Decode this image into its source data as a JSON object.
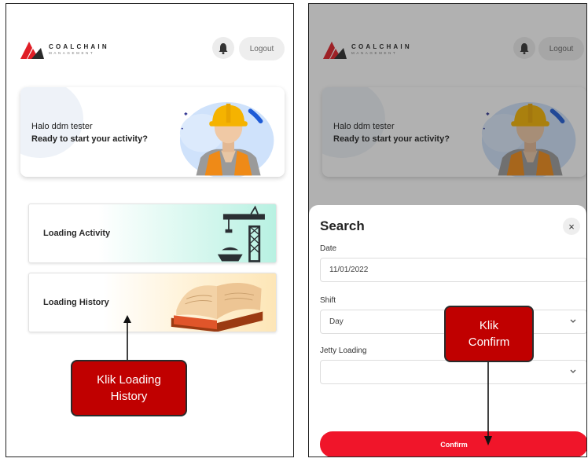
{
  "app": {
    "brand": "COALCHAIN",
    "brand_sub": "MANAGEMENT",
    "logout_label": "Logout",
    "icons": [
      "coalchain-logo-icon",
      "bell-icon",
      "worker-illustration-icon",
      "crane-icon",
      "book-icon",
      "close-icon",
      "chevron-down-icon"
    ]
  },
  "home": {
    "greeting": "Halo ddm tester",
    "subtitle": "Ready to start your activity?",
    "cards": [
      {
        "label": "Loading Activity"
      },
      {
        "label": "Loading History"
      }
    ],
    "annotation": [
      "Klik Loading",
      "History"
    ]
  },
  "search_modal": {
    "title": "Search",
    "close_label": "×",
    "date_label": "Date",
    "date_value": "11/01/2022",
    "shift_label": "Shift",
    "shift_value": "Day",
    "jetty_label": "Jetty Loading",
    "jetty_value": "",
    "confirm_label": "Confirm",
    "annotation": [
      "Klik",
      "Confirm"
    ]
  },
  "colors": {
    "accent": "#f0152a",
    "annotation_fill": "#c00000",
    "activity_card": "#b8f1e2",
    "history_card": "#fde6b7",
    "helmet": "#f5b300",
    "vest": "#ef8a17"
  }
}
